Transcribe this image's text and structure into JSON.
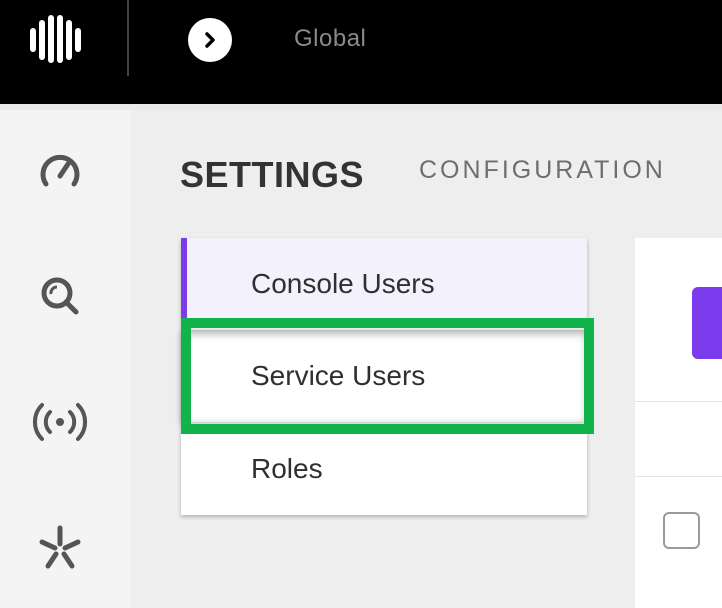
{
  "topbar": {
    "logo_icon": "brand-logo-icon",
    "nav_icon": "chevron-right-icon",
    "scope_label": "Global"
  },
  "sidebar": {
    "items": [
      {
        "icon": "dashboard-gauge-icon"
      },
      {
        "icon": "search-icon"
      },
      {
        "icon": "broadcast-icon"
      },
      {
        "icon": "spark-icon"
      }
    ]
  },
  "main": {
    "tabs": [
      {
        "label": "SETTINGS",
        "active": true
      },
      {
        "label": "CONFIGURATION",
        "active": false
      }
    ],
    "submenu": [
      {
        "label": "Console Users",
        "state": "active"
      },
      {
        "label": "Service Users",
        "state": "highlighted"
      },
      {
        "label": "Roles",
        "state": "normal"
      }
    ]
  },
  "colors": {
    "accent": "#7c3aed",
    "highlight": "#12b34a",
    "topbar": "#000000"
  }
}
